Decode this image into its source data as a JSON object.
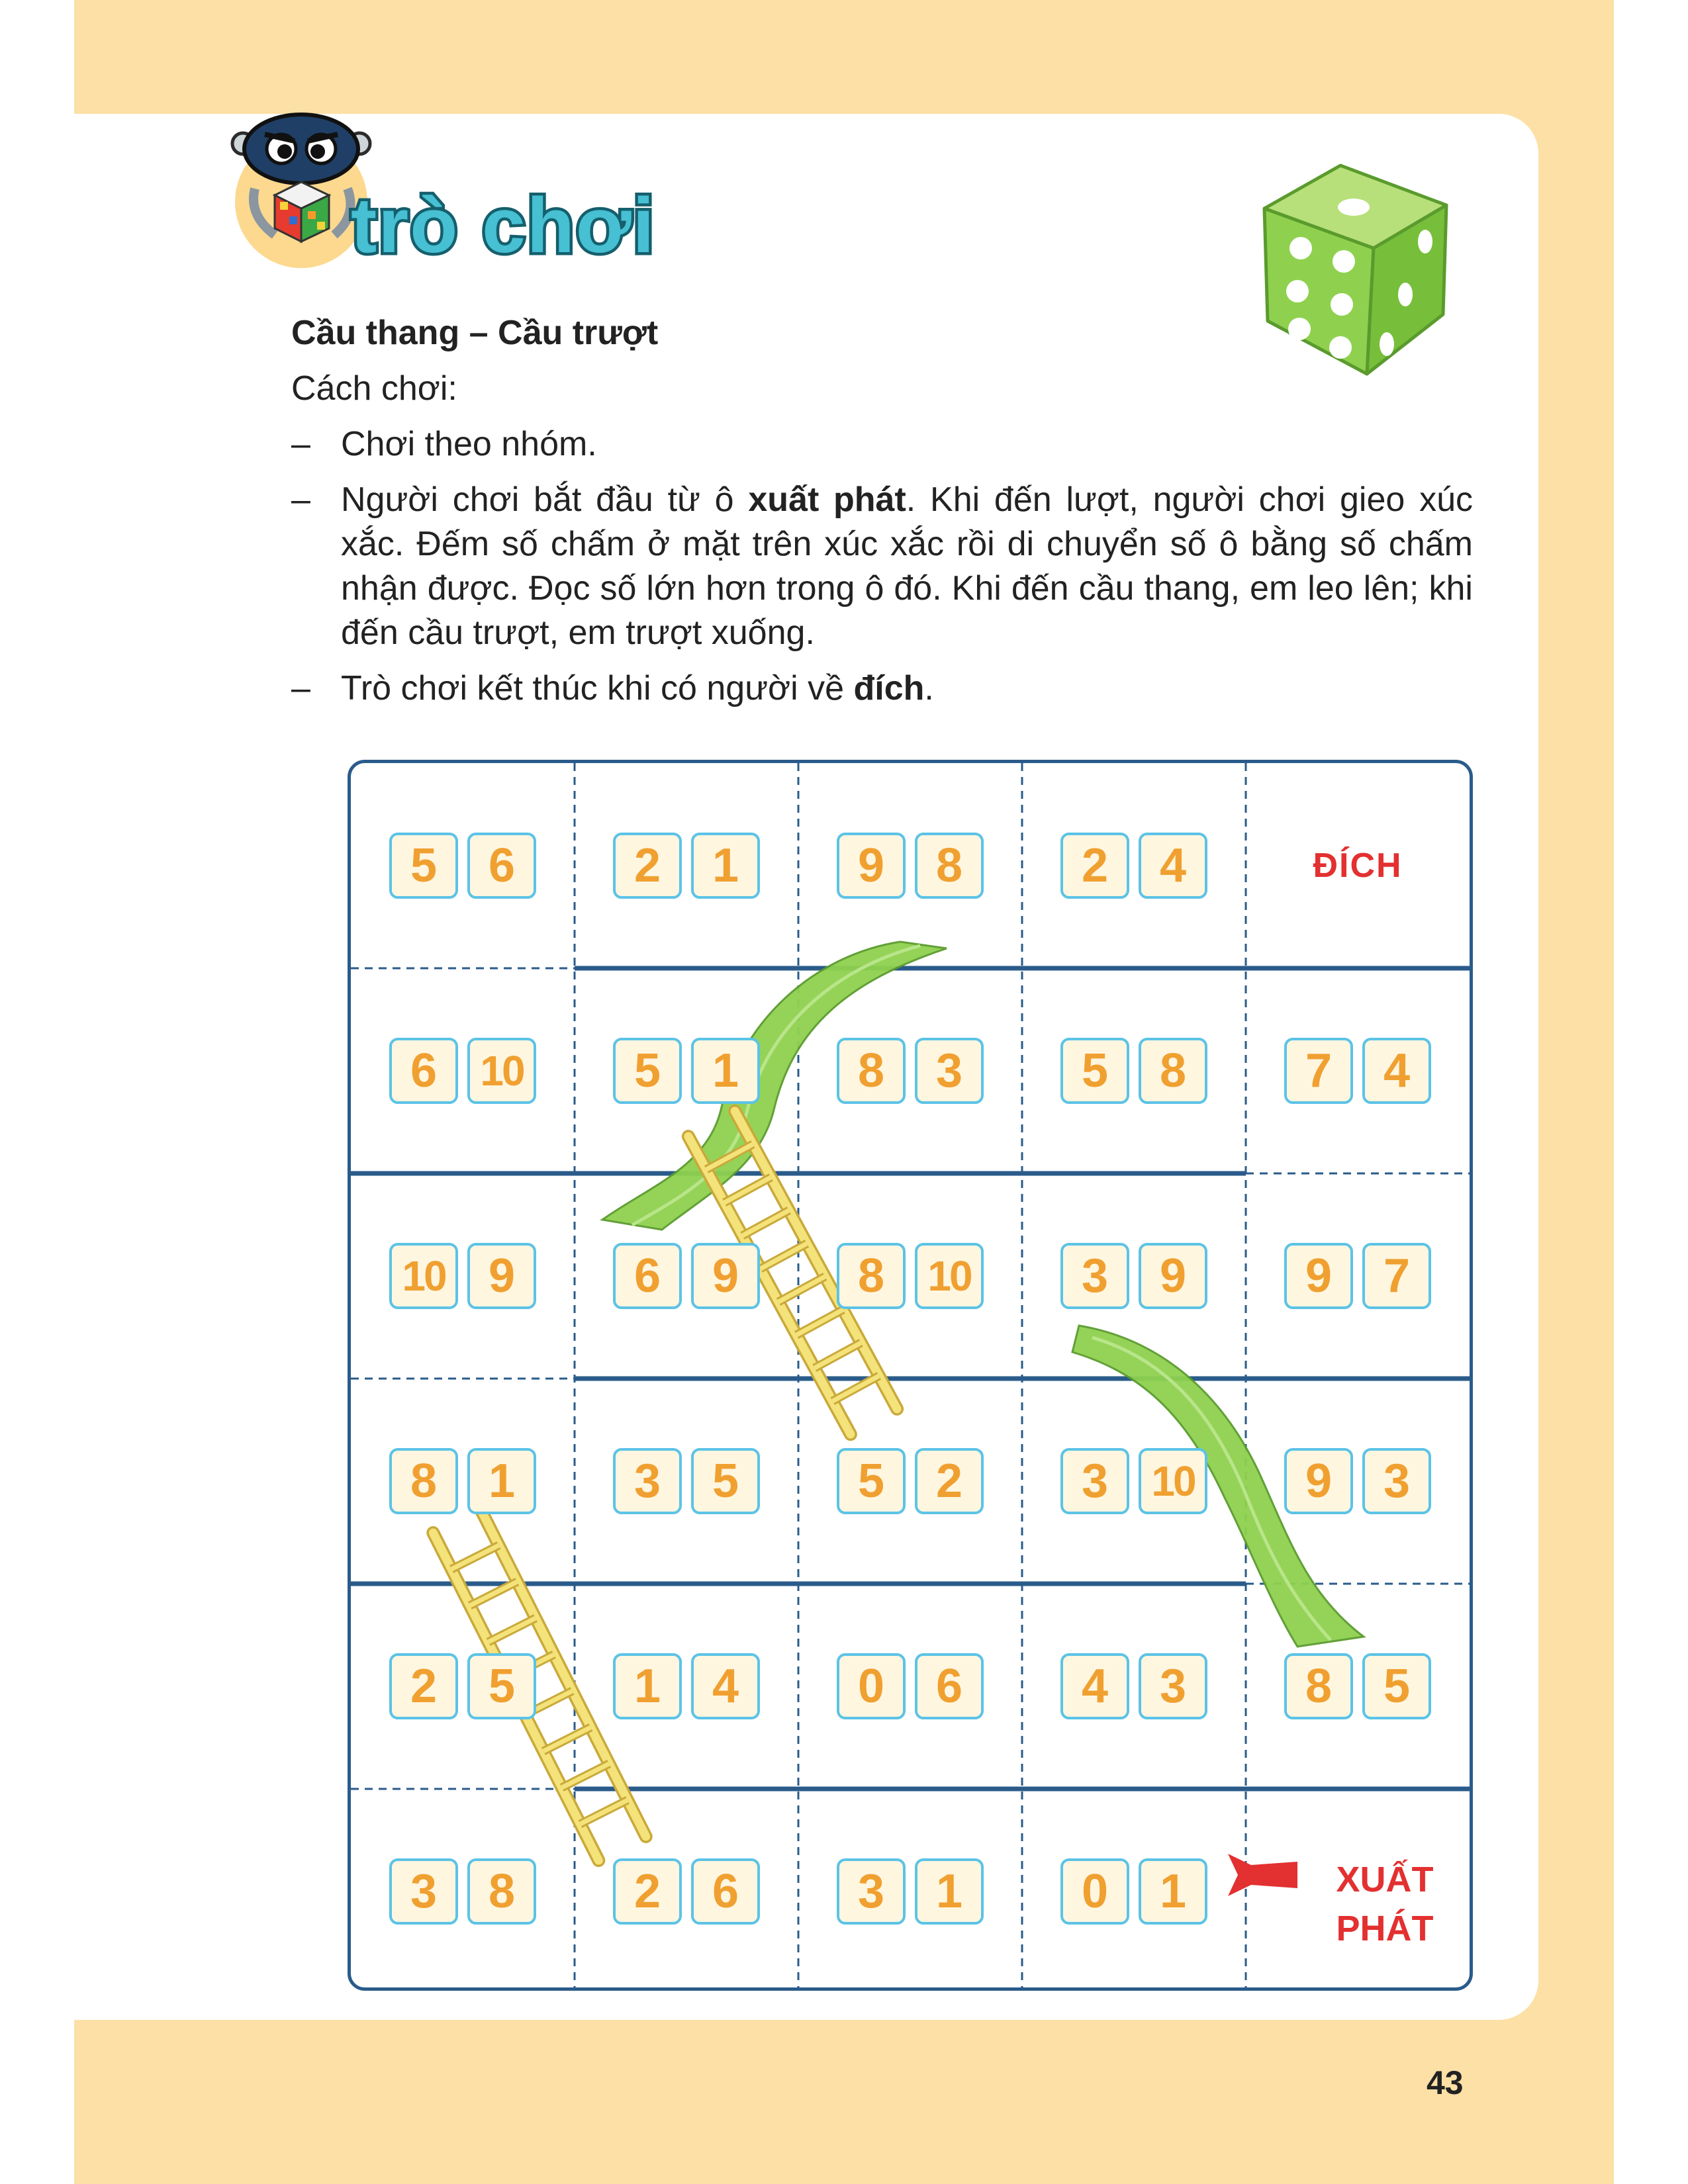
{
  "section": {
    "title": "trò chơi"
  },
  "game": {
    "title": "Cầu thang – Cầu trượt",
    "how_to_play": "Cách chơi:",
    "rules": [
      {
        "dash": "–",
        "parts": [
          {
            "text": "Chơi theo nhóm.",
            "bold": false
          }
        ]
      },
      {
        "dash": "–",
        "parts": [
          {
            "text": "Người chơi bắt đầu từ ô ",
            "bold": false
          },
          {
            "text": "xuất phát",
            "bold": true
          },
          {
            "text": ". Khi đến lượt, người chơi gieo xúc xắc. Đếm số chấm ở mặt trên xúc xắc rồi di chuyển số ô bằng số chấm nhận được. Đọc số lớn hơn trong ô đó. Khi đến cầu thang, em leo lên; khi đến cầu trượt, em trượt xuống.",
            "bold": false
          }
        ]
      },
      {
        "dash": "–",
        "parts": [
          {
            "text": "Trò chơi kết thúc khi có người về ",
            "bold": false
          },
          {
            "text": "đích",
            "bold": true
          },
          {
            "text": ".",
            "bold": false
          }
        ]
      }
    ]
  },
  "board": {
    "rows": [
      [
        [
          "5",
          "6"
        ],
        [
          "2",
          "1"
        ],
        [
          "9",
          "8"
        ],
        [
          "2",
          "4"
        ],
        "ĐÍCH"
      ],
      [
        [
          "6",
          "10"
        ],
        [
          "5",
          "1"
        ],
        [
          "8",
          "3"
        ],
        [
          "5",
          "8"
        ],
        [
          "7",
          "4"
        ]
      ],
      [
        [
          "10",
          "9"
        ],
        [
          "6",
          "9"
        ],
        [
          "8",
          "10"
        ],
        [
          "3",
          "9"
        ],
        [
          "9",
          "7"
        ]
      ],
      [
        [
          "8",
          "1"
        ],
        [
          "3",
          "5"
        ],
        [
          "5",
          "2"
        ],
        [
          "3",
          "10"
        ],
        [
          "9",
          "3"
        ]
      ],
      [
        [
          "2",
          "5"
        ],
        [
          "1",
          "4"
        ],
        [
          "0",
          "6"
        ],
        [
          "4",
          "3"
        ],
        [
          "8",
          "5"
        ]
      ],
      [
        [
          "3",
          "8"
        ],
        [
          "2",
          "6"
        ],
        [
          "3",
          "1"
        ],
        [
          "0",
          "1"
        ],
        "START"
      ]
    ],
    "start_label": [
      "XUẤT",
      "PHÁT"
    ],
    "colors": {
      "number_text": "#f0a030",
      "number_border": "#5cc3e6",
      "number_fill": "#fff6e0",
      "grid_line": "#2a5b8a",
      "label_red": "#e33030",
      "slide_green": "#8fd14f",
      "ladder_yellow": "#f4e27a"
    }
  },
  "page_number": "43"
}
